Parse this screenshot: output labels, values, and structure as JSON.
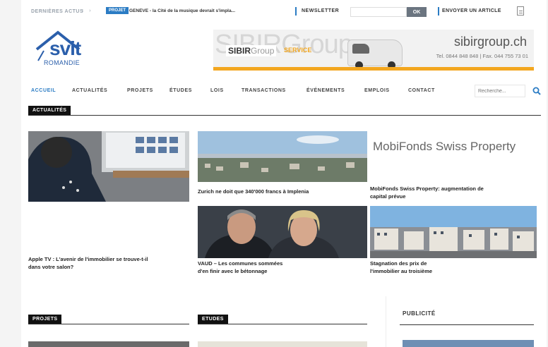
{
  "topbar": {
    "news_label": "DERNIÈRES ACTUS",
    "tag": "PROJET",
    "ticker": "GENÈVE - la Cité de la musique devrait s'impla...",
    "newsletter_label": "NEWSLETTER",
    "newsletter_placeholder": "",
    "ok_label": "OK",
    "send_label": "ENVOYER UN ARTICLE"
  },
  "logo": {
    "main": "svit",
    "sub": "ROMANDIE"
  },
  "banner": {
    "bigtext": "SIBIRGroup",
    "logo_bold": "SIBIR",
    "logo_light": "Group",
    "service": "SERVICE",
    "brand": "sibirgroup.ch",
    "contact": "Tel. 0844 848 848 | Fax. 044 755 73 01"
  },
  "nav": {
    "items": [
      "ACCUEIL",
      "ACTUALITÉS",
      "PROJETS",
      "ÉTUDES",
      "LOIS",
      "TRANSACTIONS",
      "ÉVÉNEMENTS",
      "EMPLOIS",
      "CONTACT"
    ],
    "search_placeholder": "Recherche..."
  },
  "sections": {
    "actualites": "ACTUALITÉS",
    "projets": "PROJETS",
    "etudes": "ETUDES",
    "publicite": "PUBLICITÉ"
  },
  "articles": [
    {
      "caption_l1": "Apple TV : L'avenir de l'immobilier se trouve-t-il",
      "caption_l2": "dans votre salon?"
    },
    {
      "caption_l1": "Zurich ne doit que 340'000 francs à Implenia",
      "caption_l2": ""
    },
    {
      "caption_l1": "MobiFonds Swiss Property: augmentation de",
      "caption_l2": "capital prévue",
      "image_text": "MobiFonds Swiss Property"
    },
    {
      "caption_l1": "VAUD – Les communes sommées",
      "caption_l2": "d'en finir avec le bétonnage"
    },
    {
      "caption_l1": "Stagnation des prix de",
      "caption_l2": "l'immobilier au troisième"
    }
  ],
  "colors": {
    "accent": "#2b7cc4",
    "brand": "#2b5fab",
    "banner_stripe": "#f3a71f"
  }
}
